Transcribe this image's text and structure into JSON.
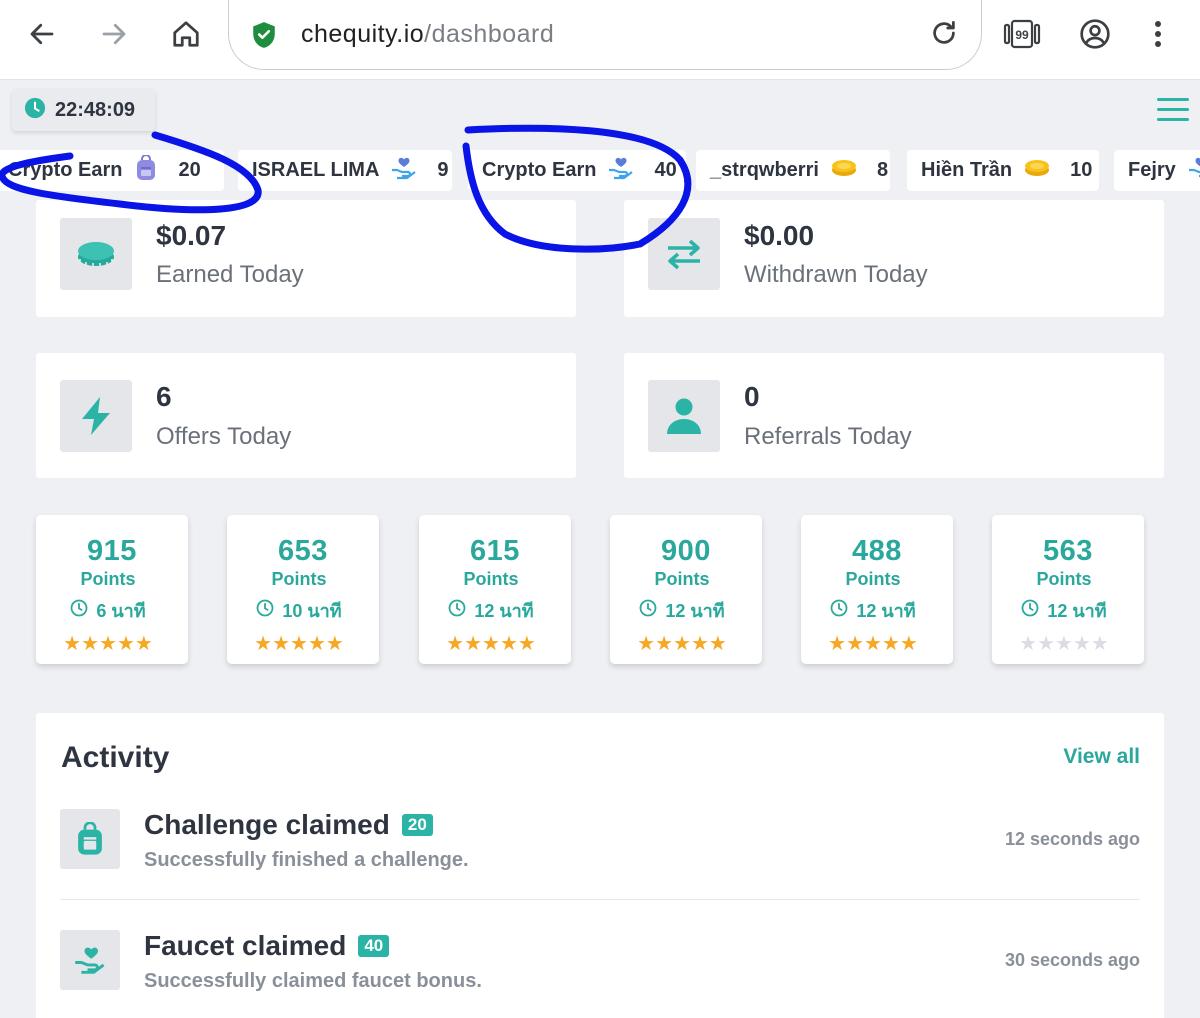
{
  "browser": {
    "url_domain": "chequity.io",
    "url_path": "/dashboard",
    "tab_count": "99",
    "icons": [
      "back-icon",
      "forward-icon",
      "home-icon",
      "shield-check-icon",
      "reload-icon",
      "tabs-icon",
      "account-icon",
      "more-icon"
    ]
  },
  "header": {
    "clock": "22:48:09",
    "accent_color": "#2bb3a6"
  },
  "ticker": [
    {
      "name": "Crypto Earn",
      "icon": "backpack-icon",
      "value": "20"
    },
    {
      "name": "ISRAEL LIMA",
      "icon": "hand-heart-icon",
      "value": "9"
    },
    {
      "name": "Crypto Earn",
      "icon": "hand-heart-icon",
      "value": "40"
    },
    {
      "name": "_strqwberri",
      "icon": "coin-icon",
      "value": "8"
    },
    {
      "name": "Hiền Trần",
      "icon": "coin-icon",
      "value": "10"
    },
    {
      "name": "Fejry",
      "icon": "hand-heart-icon",
      "value": ""
    }
  ],
  "stats": [
    {
      "value": "$0.07",
      "label": "Earned Today",
      "icon": "coin-icon"
    },
    {
      "value": "$0.00",
      "label": "Withdrawn Today",
      "icon": "transfer-icon"
    },
    {
      "value": "6",
      "label": "Offers Today",
      "icon": "lightning-icon"
    },
    {
      "value": "0",
      "label": "Referrals Today",
      "icon": "user-icon"
    }
  ],
  "offers": [
    {
      "points": "915",
      "points_label": "Points",
      "duration": "6 นาที",
      "rating": 5
    },
    {
      "points": "653",
      "points_label": "Points",
      "duration": "10 นาที",
      "rating": 5
    },
    {
      "points": "615",
      "points_label": "Points",
      "duration": "12 นาที",
      "rating": 5
    },
    {
      "points": "900",
      "points_label": "Points",
      "duration": "12 นาที",
      "rating": 5
    },
    {
      "points": "488",
      "points_label": "Points",
      "duration": "12 นาที",
      "rating": 5
    },
    {
      "points": "563",
      "points_label": "Points",
      "duration": "12 นาที",
      "rating": 0
    }
  ],
  "activity": {
    "title": "Activity",
    "view_all": "View all",
    "items": [
      {
        "title": "Challenge claimed",
        "badge": "20",
        "description": "Successfully finished a challenge.",
        "time": "12 seconds ago",
        "icon": "backpack-icon"
      },
      {
        "title": "Faucet claimed",
        "badge": "40",
        "description": "Successfully claimed faucet bonus.",
        "time": "30 seconds ago",
        "icon": "hand-heart-icon"
      }
    ]
  },
  "annotation_color": "#0a14e6"
}
